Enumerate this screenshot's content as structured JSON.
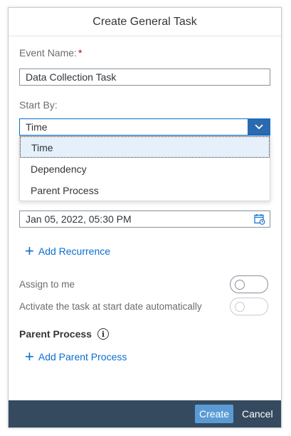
{
  "dialog": {
    "title": "Create General Task"
  },
  "form": {
    "event_name_label": "Event Name:",
    "required_marker": "*",
    "event_name_value": "Data Collection Task",
    "start_by_label": "Start By:",
    "start_by_value": "Time",
    "start_by_options": [
      "Time",
      "Dependency",
      "Parent Process"
    ],
    "date_value": "Jan 05, 2022, 05:30 PM",
    "add_recurrence": "Add Recurrence",
    "assign_to_me_label": "Assign to me",
    "activate_label": "Activate the task at start date automatically",
    "parent_process_title": "Parent Process",
    "add_parent_process": "Add Parent Process"
  },
  "footer": {
    "create": "Create",
    "cancel": "Cancel"
  },
  "colors": {
    "accent": "#0a6ed1",
    "footer_bg": "#354a5f",
    "create_btn": "#5a9bd5",
    "required": "#bb0000"
  },
  "icons": [
    "chevron-down-icon",
    "calendar-icon",
    "plus-icon",
    "info-icon"
  ]
}
